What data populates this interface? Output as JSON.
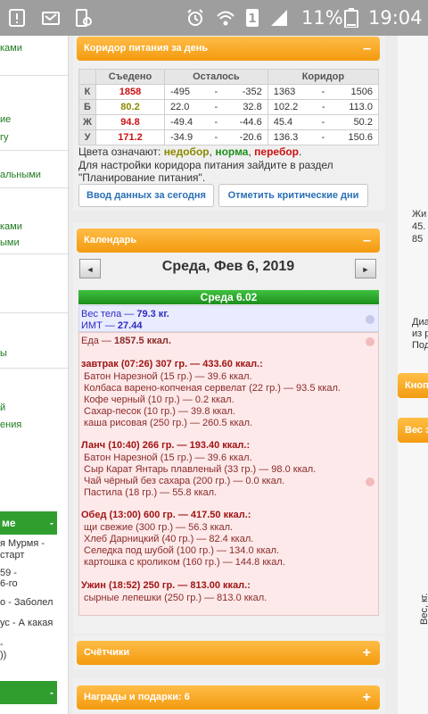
{
  "statusbar": {
    "battery_pct": "11%",
    "time": "19:04",
    "icons": [
      "alert-icon",
      "missed-call-icon",
      "device-icon",
      "alarm-icon",
      "wifi-icon",
      "sim-1-icon",
      "signal-icon",
      "battery-icon"
    ]
  },
  "left_sidebar": {
    "fragments": [
      "ками",
      "ие",
      "гу",
      "альными",
      "ками",
      "ыми",
      "ы",
      "й",
      "ения"
    ],
    "sections": [
      {
        "title": "ме",
        "control": "-"
      },
      {
        "title": "",
        "control": "-"
      }
    ],
    "links": [
      "я Мурмя -",
      "стар​т",
      "59 -",
      "6-го",
      "о - Заболел",
      "ус - А какая",
      "-",
      "))"
    ]
  },
  "corridor_panel": {
    "title": "Коридор питания за день",
    "control": "–",
    "headers": [
      "Съедено",
      "Осталось",
      "Коридор"
    ],
    "rows": [
      {
        "label": "К",
        "eaten": "1858",
        "eaten_color": "#cc1111",
        "left_a": "-495",
        "left_b": "-352",
        "range_a": "1363",
        "range_b": "1506"
      },
      {
        "label": "Б",
        "eaten": "80.2",
        "eaten_color": "#8a8a00",
        "left_a": "22.0",
        "left_b": "32.8",
        "range_a": "102.2",
        "range_b": "113.0"
      },
      {
        "label": "Ж",
        "eaten": "94.8",
        "eaten_color": "#cc1111",
        "left_a": "-49.4",
        "left_b": "-44.6",
        "range_a": "45.4",
        "range_b": "50.2"
      },
      {
        "label": "У",
        "eaten": "171.2",
        "eaten_color": "#cc1111",
        "left_a": "-34.9",
        "left_b": "-20.6",
        "range_a": "136.3",
        "range_b": "150.6"
      }
    ],
    "separator": "-",
    "legend_prefix": "Цвета означают:",
    "legend_under": "недобор",
    "legend_norm": "норма",
    "legend_over": "перебор",
    "legend_comma": ",",
    "legend_end": ".",
    "config_line1": "Для настройки коридора питания зайдите в раздел",
    "config_line2": "\"Планирование питания\".",
    "buttons": {
      "enter_today": "Ввод данных за сегодня",
      "mark_critical": "Отметить критические дни"
    }
  },
  "calendar_panel": {
    "title": "Календарь",
    "control": "–",
    "prev": "◄",
    "next": "►",
    "date": "Среда, Фев 6, 2019",
    "day_header": "Среда 6.02",
    "weight_label": "Вес тела —",
    "weight_value": "79.3 кг.",
    "bmi_label": "ИМТ —",
    "bmi_value": "27.44",
    "food_label": "Еда —",
    "food_value": "1857.5 ккал.",
    "meals": [
      {
        "title": "завтрак (07:26) 307 гр. — 433.60 ккал.:",
        "items": [
          "Батон Нарезной (15 гр.) — 39.6 ккал.",
          "Колбаса варено-копченая сервелат (22 гр.) — 93.5 ккал.",
          "Кофе черный (10 гр.) — 0.2 ккал.",
          "Сахар-песок (10 гр.) — 39.8 ккал.",
          "каша рисовая (250 гр.) — 260.5 ккал."
        ]
      },
      {
        "title": "Ланч (10:40) 266 гр. — 193.40 ккал.:",
        "items": [
          "Батон Нарезной (15 гр.) — 39.6 ккал.",
          "Сыр Карат Янтарь плавленый (33 гр.) — 98.0 ккал.",
          "Чай чёрный без сахара (200 гр.) — 0.0 ккал.",
          "Пастила (18 гр.) — 55.8 ккал."
        ]
      },
      {
        "title": "Обед (13:00) 600 гр. — 417.50 ккал.:",
        "items": [
          "щи свежие (300 гр.) — 56.3 ккал.",
          "Хлеб Дарницкий (40 гр.) — 82.4 ккал.",
          "Селедка под шубой (100 гр.) — 134.0 ккал.",
          "картошка с кроликом (160 гр.) — 144.8 ккал."
        ]
      },
      {
        "title": "Ужин (18:52) 250 гр. — 813.00 ккал.:",
        "items": [
          "сырные лепешки (250 гр.) — 813.0 ккал."
        ]
      }
    ]
  },
  "counters_panel": {
    "title": "Счётчики",
    "control": "+"
  },
  "awards_panel": {
    "title": "Награды и подарки: 6",
    "control": "+"
  },
  "right_sidebar": {
    "text1": "Жи",
    "text2": "45.",
    "text3": "85",
    "diag1": "Диагр",
    "diag2": "из раз",
    "diag3": "Подро",
    "btn1": "Кноп",
    "btn2": "Вес з",
    "axis": "Вес, кг."
  }
}
